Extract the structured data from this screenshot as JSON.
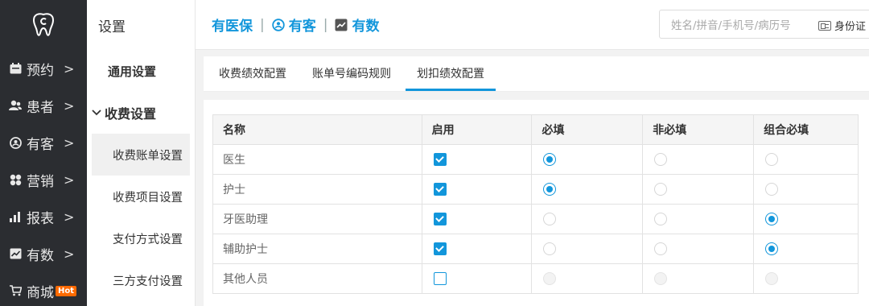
{
  "nav": {
    "items": [
      {
        "label": "预约",
        "icon": "calendar-icon"
      },
      {
        "label": "患者",
        "icon": "users-icon"
      },
      {
        "label": "有客",
        "icon": "youke-icon"
      },
      {
        "label": "营销",
        "icon": "marketing-icon"
      },
      {
        "label": "报表",
        "icon": "bar-chart-icon"
      },
      {
        "label": "有数",
        "icon": "trend-icon"
      },
      {
        "label": "商城",
        "icon": "cart-icon",
        "badge": "Hot"
      }
    ],
    "chevron": ">"
  },
  "submenu": {
    "title": "设置",
    "general": "通用设置",
    "charge_group": "收费设置",
    "items": [
      "收费账单设置",
      "收费项目设置",
      "支付方式设置",
      "三方支付设置"
    ]
  },
  "header": {
    "brand1": "有医保",
    "brand2": "有客",
    "brand3": "有数",
    "separator": "|",
    "search_placeholder": "姓名/拼音/手机号/病历号",
    "idcard_label": "身份证"
  },
  "tabs": [
    "收费绩效配置",
    "账单号编码规则",
    "划扣绩效配置"
  ],
  "table": {
    "headers": [
      "名称",
      "启用",
      "必填",
      "非必填",
      "组合必填"
    ],
    "rows": [
      {
        "name": "医生",
        "enabled": true,
        "choice": "required"
      },
      {
        "name": "护士",
        "enabled": true,
        "choice": "required"
      },
      {
        "name": "牙医助理",
        "enabled": true,
        "choice": "combo"
      },
      {
        "name": "辅助护士",
        "enabled": true,
        "choice": "combo"
      },
      {
        "name": "其他人员",
        "enabled": false,
        "choice": "none"
      }
    ]
  },
  "colors": {
    "accent": "#1296db",
    "nav_bg": "#2b2d31",
    "hot": "#ff6a00"
  }
}
